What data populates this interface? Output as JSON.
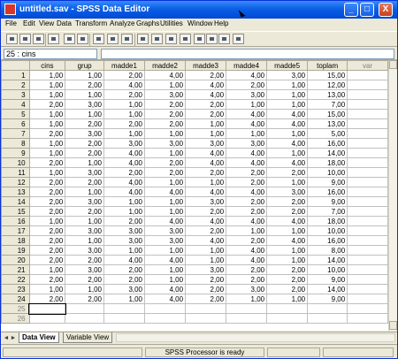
{
  "window": {
    "title": "untitled.sav - SPSS Data Editor",
    "controls": {
      "minimize": "_",
      "maximize": "□",
      "close": "X"
    }
  },
  "menu": [
    "File",
    "Edit",
    "View",
    "Data",
    "Transform",
    "Analyze",
    "Graphs",
    "Utilities",
    "Window",
    "Help"
  ],
  "toolbar": {
    "buttons": [
      "open-icon",
      "save-icon",
      "print-icon",
      "dialog-recall-icon",
      "undo-icon",
      "redo-icon",
      "goto-chart-icon",
      "goto-case-icon",
      "variables-icon",
      "find-icon",
      "insert-case-icon",
      "insert-variable-icon",
      "split-file-icon",
      "weight-cases-icon",
      "select-cases-icon",
      "value-labels-icon",
      "use-sets-icon"
    ]
  },
  "cell_editor": {
    "reference": "25 : cins",
    "value": ""
  },
  "grid": {
    "columns": [
      "cins",
      "grup",
      "madde1",
      "madde2",
      "madde3",
      "madde4",
      "madde5",
      "toplam",
      "var"
    ],
    "rows": [
      [
        "1",
        "1,00",
        "1,00",
        "2,00",
        "4,00",
        "2,00",
        "4,00",
        "3,00",
        "15,00"
      ],
      [
        "2",
        "1,00",
        "2,00",
        "4,00",
        "1,00",
        "4,00",
        "2,00",
        "1,00",
        "12,00"
      ],
      [
        "3",
        "1,00",
        "1,00",
        "2,00",
        "3,00",
        "4,00",
        "3,00",
        "1,00",
        "13,00"
      ],
      [
        "4",
        "2,00",
        "3,00",
        "1,00",
        "2,00",
        "2,00",
        "1,00",
        "1,00",
        "7,00"
      ],
      [
        "5",
        "1,00",
        "1,00",
        "1,00",
        "2,00",
        "2,00",
        "4,00",
        "4,00",
        "15,00"
      ],
      [
        "6",
        "1,00",
        "2,00",
        "2,00",
        "2,00",
        "1,00",
        "4,00",
        "4,00",
        "13,00"
      ],
      [
        "7",
        "2,00",
        "3,00",
        "1,00",
        "1,00",
        "1,00",
        "1,00",
        "1,00",
        "5,00"
      ],
      [
        "8",
        "1,00",
        "2,00",
        "3,00",
        "3,00",
        "3,00",
        "3,00",
        "4,00",
        "16,00"
      ],
      [
        "9",
        "1,00",
        "2,00",
        "4,00",
        "1,00",
        "4,00",
        "4,00",
        "1,00",
        "14,00"
      ],
      [
        "10",
        "2,00",
        "1,00",
        "4,00",
        "2,00",
        "4,00",
        "4,00",
        "4,00",
        "18,00"
      ],
      [
        "11",
        "1,00",
        "3,00",
        "2,00",
        "2,00",
        "2,00",
        "2,00",
        "2,00",
        "10,00"
      ],
      [
        "12",
        "2,00",
        "2,00",
        "4,00",
        "1,00",
        "1,00",
        "2,00",
        "1,00",
        "9,00"
      ],
      [
        "13",
        "2,00",
        "1,00",
        "4,00",
        "4,00",
        "4,00",
        "4,00",
        "3,00",
        "16,00"
      ],
      [
        "14",
        "2,00",
        "3,00",
        "1,00",
        "1,00",
        "3,00",
        "2,00",
        "2,00",
        "9,00"
      ],
      [
        "15",
        "2,00",
        "2,00",
        "1,00",
        "1,00",
        "2,00",
        "2,00",
        "2,00",
        "7,00"
      ],
      [
        "16",
        "1,00",
        "1,00",
        "2,00",
        "4,00",
        "4,00",
        "4,00",
        "4,00",
        "18,00"
      ],
      [
        "17",
        "2,00",
        "3,00",
        "3,00",
        "3,00",
        "2,00",
        "1,00",
        "1,00",
        "10,00"
      ],
      [
        "18",
        "2,00",
        "1,00",
        "3,00",
        "3,00",
        "4,00",
        "2,00",
        "4,00",
        "16,00"
      ],
      [
        "19",
        "2,00",
        "3,00",
        "1,00",
        "1,00",
        "1,00",
        "4,00",
        "1,00",
        "8,00"
      ],
      [
        "20",
        "2,00",
        "2,00",
        "4,00",
        "4,00",
        "1,00",
        "4,00",
        "1,00",
        "14,00"
      ],
      [
        "21",
        "1,00",
        "3,00",
        "2,00",
        "1,00",
        "3,00",
        "2,00",
        "2,00",
        "10,00"
      ],
      [
        "22",
        "2,00",
        "2,00",
        "2,00",
        "1,00",
        "2,00",
        "2,00",
        "2,00",
        "9,00"
      ],
      [
        "23",
        "1,00",
        "1,00",
        "3,00",
        "4,00",
        "2,00",
        "3,00",
        "2,00",
        "14,00"
      ],
      [
        "24",
        "2,00",
        "2,00",
        "1,00",
        "4,00",
        "2,00",
        "1,00",
        "1,00",
        "9,00"
      ]
    ],
    "empty_rows": [
      "25",
      "26"
    ]
  },
  "tabs": {
    "nav": [
      "◄",
      "►"
    ],
    "items": [
      "Data View",
      "Variable View"
    ],
    "active": "Data View"
  },
  "status": {
    "text": "SPSS Processor  is ready"
  },
  "colors": {
    "titlebar": "#0a5fe6",
    "chrome": "#ece9d8",
    "grid_line": "#c0c0c0"
  }
}
